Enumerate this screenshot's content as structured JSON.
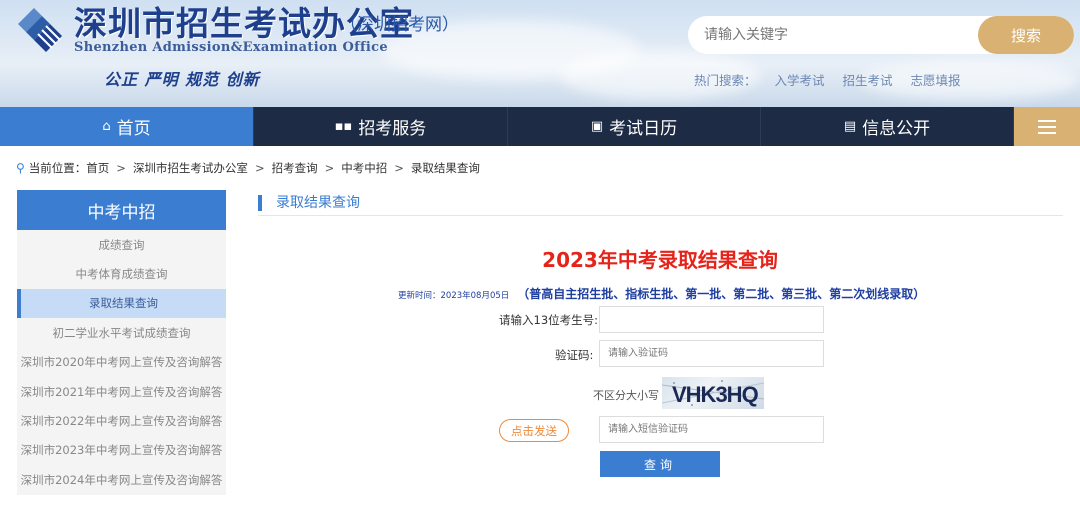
{
  "header": {
    "title": "深圳市招生考试办公室",
    "subtitle": "（深圳招考网）",
    "english_name": "Shenzhen Admission&Examination Office",
    "slogan": "公正 严明 规范 创新",
    "search": {
      "placeholder": "请输入关键字",
      "button_label": "搜索"
    },
    "hot_search": {
      "label": "热门搜索：",
      "items": [
        "入学考试",
        "招生考试",
        "志愿填报"
      ]
    }
  },
  "nav": {
    "items": [
      {
        "label": "首页",
        "icon": "home-icon",
        "active": true
      },
      {
        "label": "招考服务",
        "icon": "grid-icon",
        "active": false
      },
      {
        "label": "考试日历",
        "icon": "calendar-icon",
        "active": false
      },
      {
        "label": "信息公开",
        "icon": "document-icon",
        "active": false
      }
    ],
    "menu_icon": "menu-icon"
  },
  "breadcrumb": {
    "label": "当前位置：",
    "items": [
      "首页",
      "深圳市招生考试办公室",
      "招考查询",
      "中考中招",
      "录取结果查询"
    ]
  },
  "sidebar": {
    "title": "中考中招",
    "items": [
      {
        "label": "成绩查询",
        "active": false
      },
      {
        "label": "中考体育成绩查询",
        "active": false
      },
      {
        "label": "录取结果查询",
        "active": true
      },
      {
        "label": "初二学业水平考试成绩查询",
        "active": false
      },
      {
        "label": "深圳市2020年中考网上宣传及咨询解答",
        "active": false
      },
      {
        "label": "深圳市2021年中考网上宣传及咨询解答",
        "active": false
      },
      {
        "label": "深圳市2022年中考网上宣传及咨询解答",
        "active": false
      },
      {
        "label": "深圳市2023年中考网上宣传及咨询解答",
        "active": false
      },
      {
        "label": "深圳市2024年中考网上宣传及咨询解答",
        "active": false
      }
    ]
  },
  "main": {
    "section_title": "录取结果查询",
    "title": "2023年中考录取结果查询",
    "update_time": "更新时间：2023年08月05日",
    "batches": "（普高自主招生批、指标生批、第一批、第二批、第三批、第二次划线录取）",
    "form": {
      "exam_no_label": "请输入13位考生号:",
      "exam_no_value": "",
      "captcha_label": "验证码:",
      "captcha_placeholder": "请输入验证码",
      "case_hint": "不区分大小写",
      "captcha_text": "VHK3HQ",
      "send_button": "点击发送",
      "sms_placeholder": "请输入短信验证码",
      "query_button": "查询"
    }
  },
  "colors": {
    "primary_blue": "#3a7dd1",
    "nav_dark": "#1d2b44",
    "gold": "#d9b172",
    "title_red": "#e5231a",
    "batch_blue": "#1f3fa0",
    "send_orange": "#f08a3a"
  }
}
